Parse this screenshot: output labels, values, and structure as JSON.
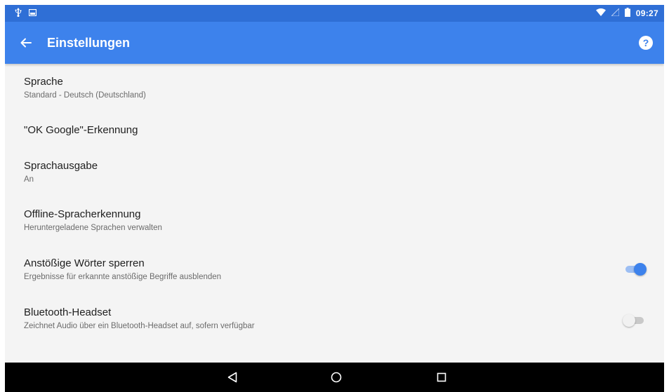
{
  "status_bar": {
    "time": "09:27",
    "icons": [
      "usb-icon",
      "screenshot-icon",
      "wifi-icon",
      "signal-icon",
      "battery-icon"
    ]
  },
  "app_bar": {
    "title": "Einstellungen",
    "back_icon": "arrow-left-icon",
    "help_icon": "help-icon",
    "help_glyph": "?"
  },
  "settings": [
    {
      "title": "Sprache",
      "summary": "Standard - Deutsch (Deutschland)"
    },
    {
      "title": "\"OK Google\"-Erkennung",
      "summary": ""
    },
    {
      "title": "Sprachausgabe",
      "summary": "An"
    },
    {
      "title": "Offline-Spracherkennung",
      "summary": "Heruntergeladene Sprachen verwalten"
    },
    {
      "title": "Anstößige Wörter sperren",
      "summary": "Ergebnisse für erkannte anstößige Begriffe ausblenden",
      "toggle": true
    },
    {
      "title": "Bluetooth-Headset",
      "summary": "Zeichnet Audio über ein Bluetooth-Headset auf, sofern verfügbar",
      "toggle": false
    }
  ],
  "nav_bar": {
    "icons": [
      "back-triangle-icon",
      "home-circle-icon",
      "recents-square-icon"
    ]
  },
  "colors": {
    "status_bar": "#2f6fd6",
    "app_bar": "#3d82ec",
    "accent": "#3d82ec",
    "background": "#f4f4f4"
  }
}
